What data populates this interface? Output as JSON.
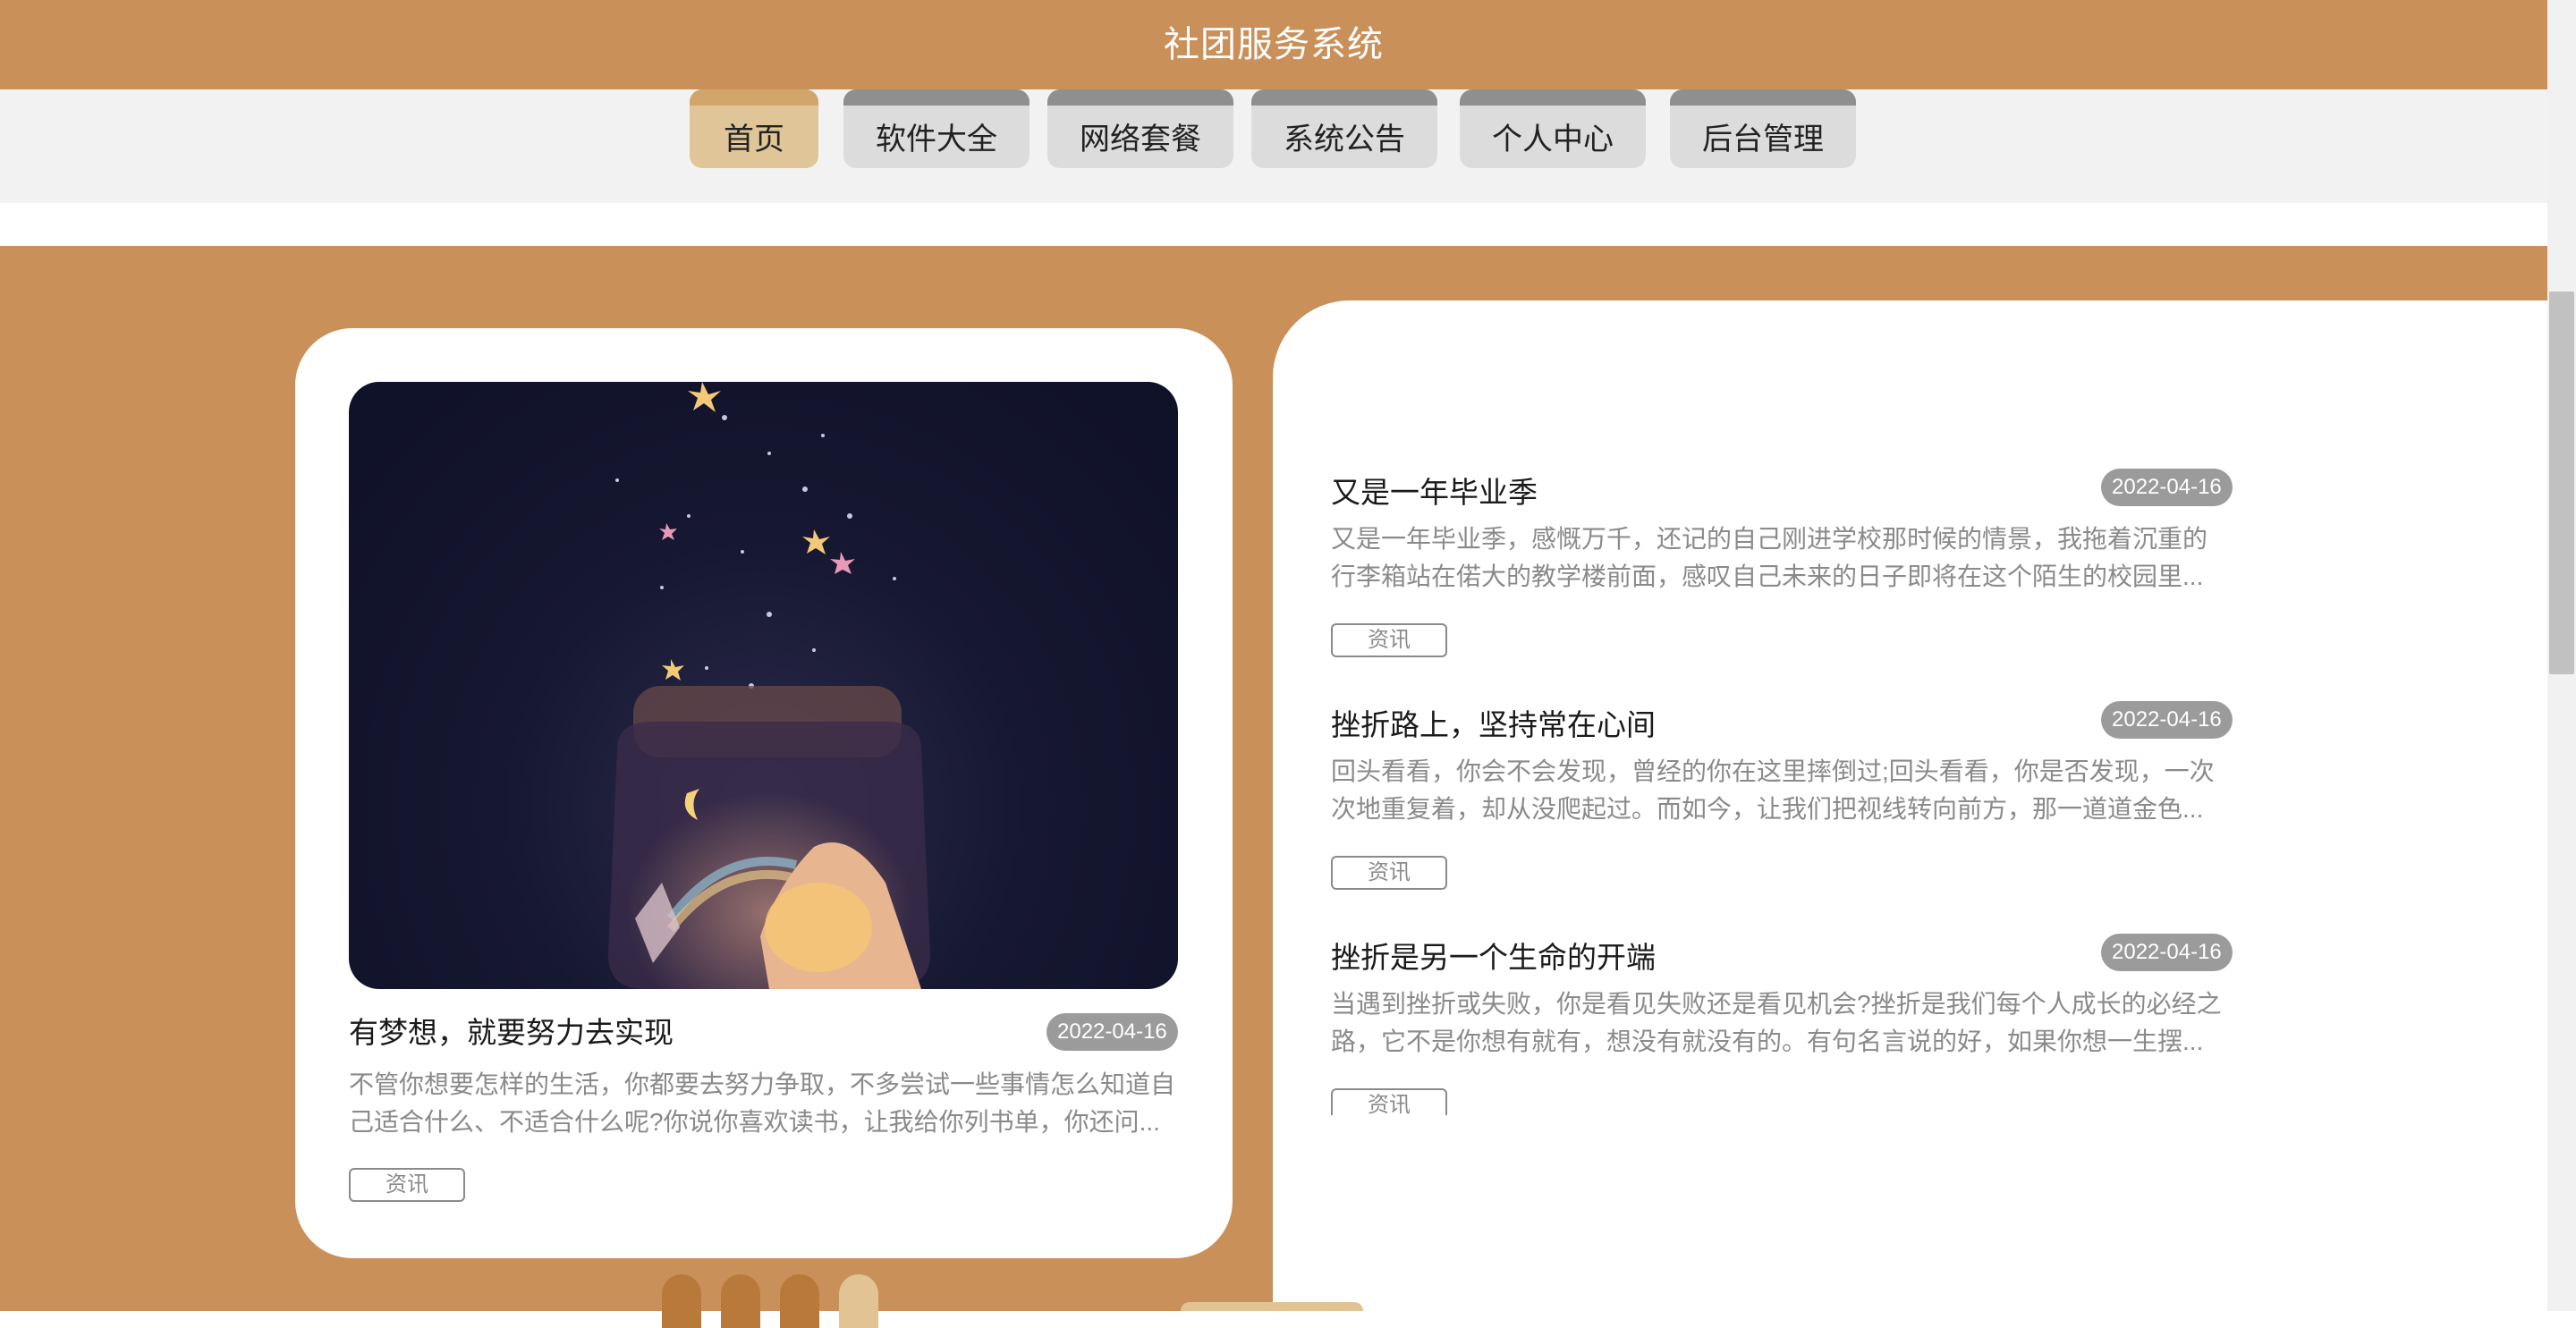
{
  "header": {
    "title": "社团服务系统"
  },
  "nav": {
    "items": [
      {
        "label": "首页",
        "active": true
      },
      {
        "label": "软件大全",
        "active": false
      },
      {
        "label": "网络套餐",
        "active": false
      },
      {
        "label": "系统公告",
        "active": false
      },
      {
        "label": "个人中心",
        "active": false
      },
      {
        "label": "后台管理",
        "active": false
      }
    ]
  },
  "featured": {
    "image_icon": "starry-jar-photo",
    "title": "有梦想，就要努力去实现",
    "date": "2022-04-16",
    "excerpt_line1": "不管你想要怎样的生活，你都要去努力争取，不多尝试一些事情怎么知道自",
    "excerpt_line2": "己适合什么、不适合什么呢?你说你喜欢读书，让我给你列书单，你还问...",
    "tag": "资讯"
  },
  "news": [
    {
      "title": "又是一年毕业季",
      "date": "2022-04-16",
      "excerpt_line1": "又是一年毕业季，感慨万千，还记的自己刚进学校那时候的情景，我拖着沉重的",
      "excerpt_line2": "行李箱站在偌大的教学楼前面，感叹自己未来的日子即将在这个陌生的校园里...",
      "tag": "资讯"
    },
    {
      "title": "挫折路上，坚持常在心间",
      "date": "2022-04-16",
      "excerpt_line1": "回头看看，你会不会发现，曾经的你在这里摔倒过;回头看看，你是否发现，一次",
      "excerpt_line2": "次地重复着，却从没爬起过。而如今，让我们把视线转向前方，那一道道金色...",
      "tag": "资讯"
    },
    {
      "title": "挫折是另一个生命的开端",
      "date": "2022-04-16",
      "excerpt_line1": "当遇到挫折或失败，你是看见失败还是看见机会?挫折是我们每个人成长的必经之",
      "excerpt_line2": "路，它不是你想有就有，想没有就没有的。有句名言说的好，如果你想一生摆...",
      "tag": "资讯"
    }
  ],
  "colors": {
    "brand": "#c99159",
    "active_tab": "#e0c598",
    "tab": "#dcdcdc",
    "date_badge": "#9b9b9b"
  }
}
